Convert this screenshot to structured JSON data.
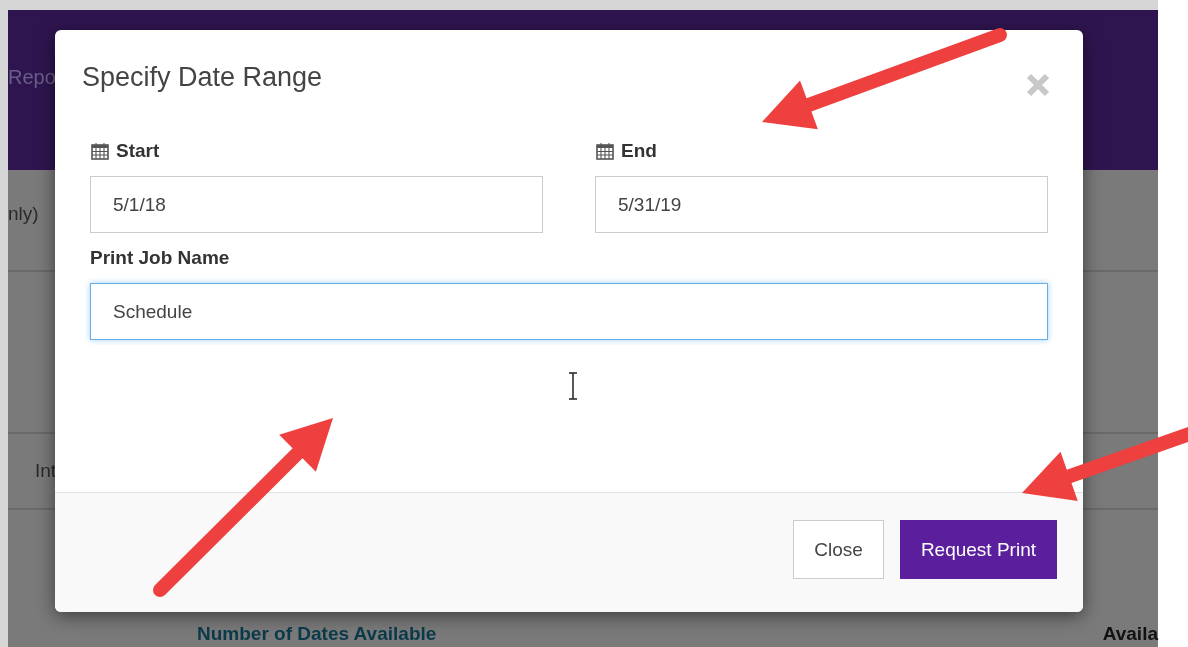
{
  "background": {
    "header_text": "Repo",
    "row_texts": [
      "nly)",
      "Int"
    ],
    "footer_texts": [
      "Number of Dates Available",
      "Availa"
    ]
  },
  "dialog": {
    "title": "Specify Date Range",
    "fields": [
      {
        "kind": "date",
        "label": "Start",
        "value": "5/1/18",
        "focused": false
      },
      {
        "kind": "date",
        "label": "End",
        "value": "5/31/19",
        "focused": false
      },
      {
        "kind": "text",
        "label": "Print Job Name",
        "value": "Schedule",
        "focused": true
      }
    ],
    "buttons": [
      {
        "kind": "default",
        "label": "Close"
      },
      {
        "kind": "primary",
        "label": "Request Print"
      }
    ]
  }
}
